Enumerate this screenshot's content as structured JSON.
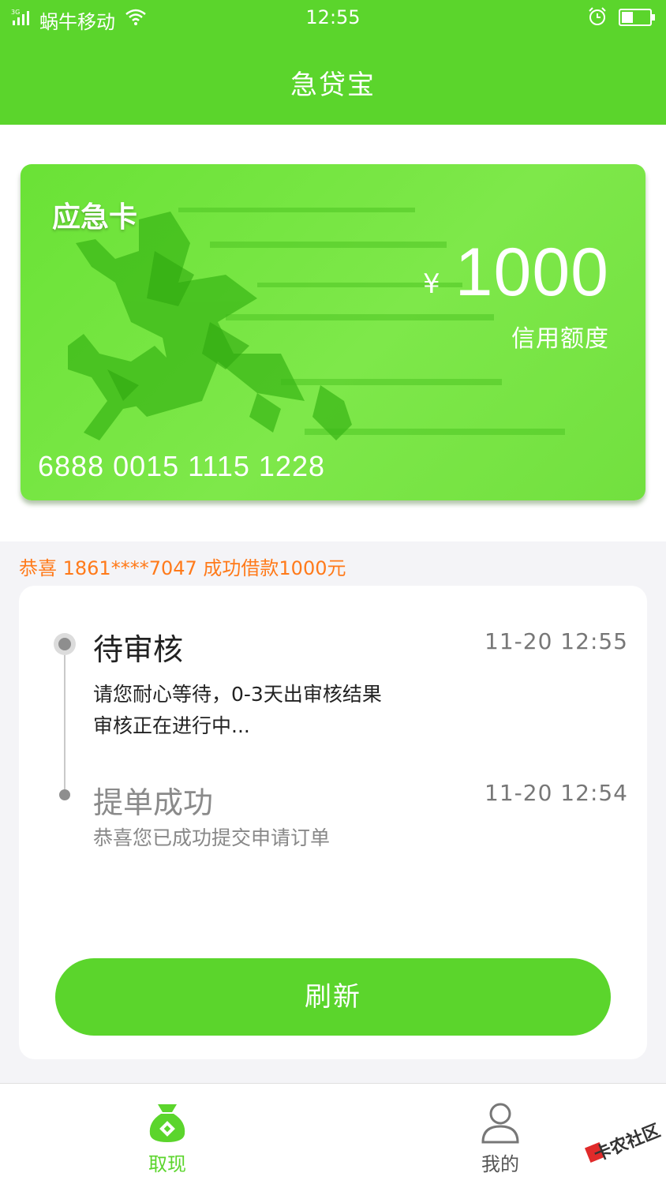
{
  "status_bar": {
    "network": "3G",
    "carrier": "蜗牛移动",
    "time": "12:55"
  },
  "header": {
    "title": "急贷宝"
  },
  "card": {
    "name": "应急卡",
    "currency": "¥",
    "amount": "1000",
    "limit_label": "信用额度",
    "number": "6888 0015 1115 1228"
  },
  "notice": "恭喜 1861****7047 成功借款1000元",
  "timeline": [
    {
      "title": "待审核",
      "time": "11-20  12:55",
      "desc": [
        "请您耐心等待，0-3天出审核结果",
        "审核正在进行中..."
      ]
    },
    {
      "title": "提单成功",
      "time": "11-20 12:54",
      "desc": [
        "恭喜您已成功提交申请订单"
      ]
    }
  ],
  "refresh_label": "刷新",
  "tabs": [
    {
      "label": "取现",
      "icon": "money-bag-icon",
      "active": true
    },
    {
      "label": "我的",
      "icon": "user-icon",
      "active": false
    }
  ],
  "watermark": "卡农社区",
  "colors": {
    "primary": "#5bd52c",
    "notice": "#ff7a1a"
  }
}
